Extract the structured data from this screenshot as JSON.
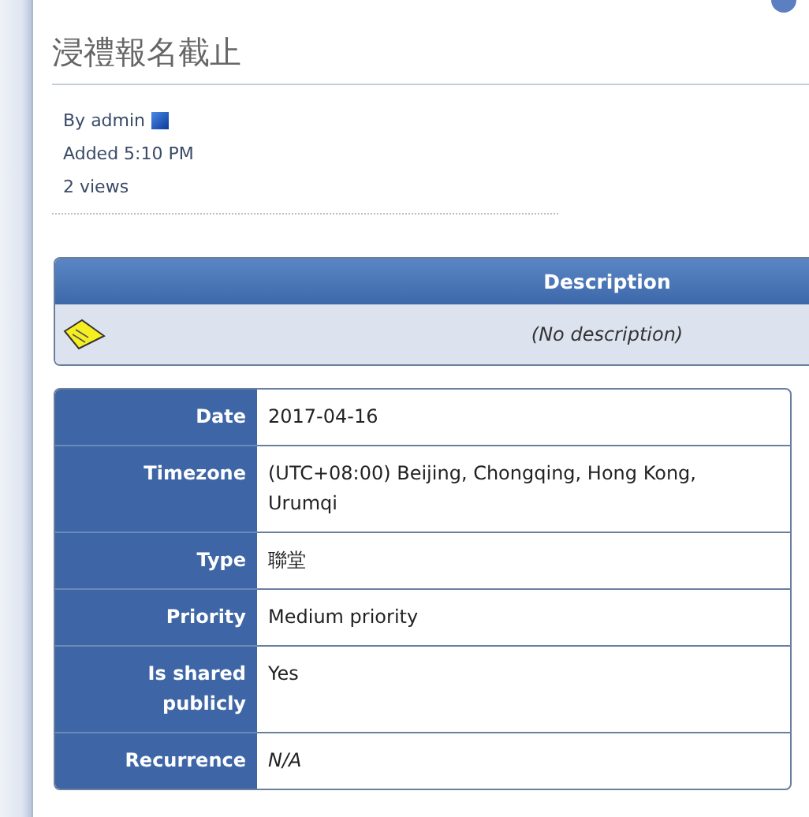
{
  "title": "浸禮報名截止",
  "meta": {
    "author_prefix": "By",
    "author": "admin",
    "added": "Added 5:10 PM",
    "views": "2 views"
  },
  "description": {
    "heading": "Description",
    "text": "(No description)"
  },
  "details": [
    {
      "label": "Date",
      "value": "2017-04-16",
      "italic": false
    },
    {
      "label": "Timezone",
      "value": "(UTC+08:00) Beijing, Chongqing, Hong Kong, Urumqi",
      "italic": false
    },
    {
      "label": "Type",
      "value": "聯堂",
      "italic": false
    },
    {
      "label": "Priority",
      "value": "Medium priority",
      "italic": false
    },
    {
      "label": "Is shared publicly",
      "value": "Yes",
      "italic": false
    },
    {
      "label": "Recurrence",
      "value": "N/A",
      "italic": true
    }
  ]
}
